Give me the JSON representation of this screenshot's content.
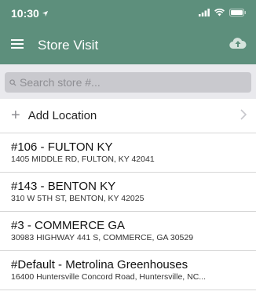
{
  "status_bar": {
    "time": "10:30",
    "location_icon": "location-arrow-icon",
    "signal_icon": "signal-bars-icon",
    "wifi_icon": "wifi-icon",
    "battery_icon": "battery-icon"
  },
  "header": {
    "title": "Store Visit",
    "menu_icon": "hamburger-menu-icon",
    "upload_icon": "cloud-upload-icon"
  },
  "search": {
    "placeholder": "Search store #..."
  },
  "add_location": {
    "label": "Add Location"
  },
  "stores": [
    {
      "name": "#106 - FULTON KY",
      "address": "1405 MIDDLE RD, FULTON, KY 42041"
    },
    {
      "name": "#143 - BENTON KY",
      "address": "310 W 5TH ST, BENTON, KY 42025"
    },
    {
      "name": "#3 - COMMERCE GA",
      "address": "30983 HIGHWAY 441 S, COMMERCE, GA 30529"
    },
    {
      "name": "#Default - Metrolina Greenhouses",
      "address": "16400 Huntersville Concord Road, Huntersville, NC..."
    }
  ],
  "colors": {
    "header_bg": "#5d8f7c",
    "search_bg": "#e9e9ed",
    "search_field": "#c9c9ce"
  }
}
